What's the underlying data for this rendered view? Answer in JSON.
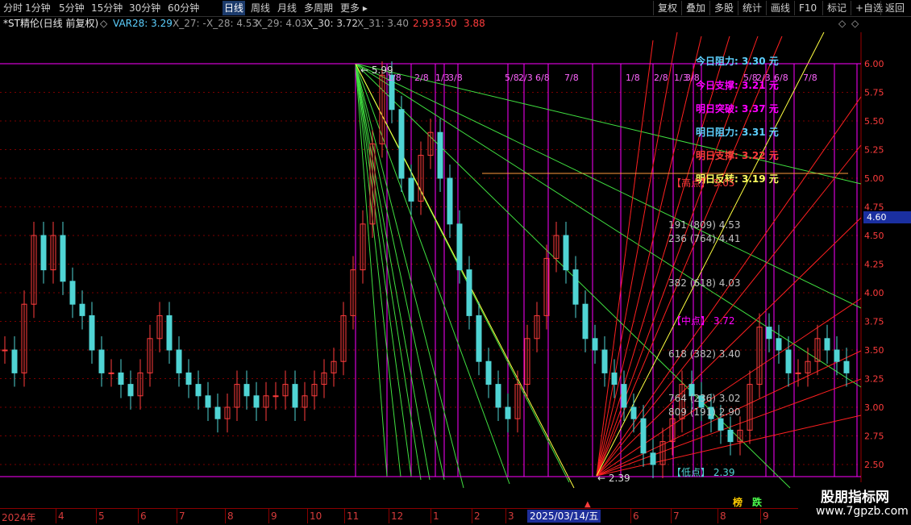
{
  "toolbar": {
    "periods": [
      "分时",
      "1分钟",
      "5分钟",
      "15分钟",
      "30分钟",
      "60分钟",
      "日线",
      "周线",
      "月线",
      "多周期",
      "更多"
    ],
    "active": "日线",
    "right": [
      "复权",
      "叠加",
      "多股",
      "统计",
      "画线",
      "F10",
      "标记",
      "+自选",
      "返回"
    ]
  },
  "info": {
    "title": "*ST精伦(日线 前复权)",
    "var28": "VAR28: 3.29",
    "x27": "X_27: -",
    "x28": "X_28: 4.53",
    "x29": "X_29: 4.03",
    "x30": "X_30: 3.72",
    "x31": "X_31: 3.40",
    "v1": "2.93",
    "v2": "3.50",
    "v3": "3.88"
  },
  "colors": {
    "bull": "#ff3c3c",
    "bear": "#50d4d4",
    "accent": "#ff00ff",
    "grid": "#8a0000"
  },
  "levels": {
    "today_resist": "今日阻力: 3.30 元",
    "today_support": "今日支撑: 3.21 元",
    "tomorrow_break": "明日突破: 3.37 元",
    "tomorrow_resist": "明日阻力: 3.31 元",
    "tomorrow_support": "明日支撑: 3.22 元",
    "tomorrow_reverse": "明日反转: 3.19 元"
  },
  "fib": {
    "high_label": "【高点】 5.05",
    "r191": "191 (809) 4.53",
    "r236": "236 (764) 4.41",
    "r382": "382 (618) 4.03",
    "mid": "【中点】 3.72",
    "r618": "618 (382) 3.40",
    "r764": "764 (236) 3.02",
    "r809": "809 (191) 2.90",
    "low_label": "【低点】 2.39"
  },
  "markers": {
    "peak": "5.99",
    "trough": "2.39",
    "price_now": "4.60",
    "fractions1": [
      "1/8",
      "2/8",
      "1/3",
      "3/8",
      "5/8",
      "2/3",
      "6/8",
      "7/8"
    ],
    "fractions2": [
      "1/8",
      "2/8",
      "1/3",
      "3/8",
      "5/8",
      "2/3",
      "6/8",
      "7/8"
    ],
    "bottom_tags": [
      "榜",
      "跌"
    ]
  },
  "yaxis": [
    "6.00",
    "5.75",
    "5.50",
    "5.25",
    "5.00",
    "4.75",
    "4.50",
    "4.25",
    "4.00",
    "3.75",
    "3.50",
    "3.25",
    "3.00",
    "2.75",
    "2.50"
  ],
  "xaxis": {
    "months": [
      "2024年",
      "4",
      "5",
      "6",
      "7",
      "8",
      "9",
      "10",
      "11",
      "12",
      "1",
      "2",
      "3",
      "5",
      "6",
      "7",
      "8",
      "9"
    ],
    "date_box": "2025/03/14/五"
  },
  "chart_data": {
    "type": "candlestick",
    "ylim": [
      2.39,
      6.0
    ],
    "closes": [
      3.5,
      3.3,
      3.9,
      4.5,
      4.2,
      4.5,
      4.1,
      3.9,
      3.8,
      3.5,
      3.3,
      3.3,
      3.2,
      3.1,
      3.3,
      3.6,
      3.8,
      3.5,
      3.3,
      3.2,
      3.1,
      3.0,
      2.9,
      3.0,
      3.2,
      3.1,
      3.0,
      3.1,
      3.1,
      3.2,
      3.0,
      3.1,
      3.2,
      3.3,
      3.4,
      3.8,
      4.2,
      4.6,
      5.3,
      5.9,
      5.6,
      5.0,
      4.8,
      5.2,
      5.4,
      5.0,
      4.6,
      4.2,
      3.8,
      3.4,
      3.2,
      3.0,
      2.9,
      3.2,
      3.6,
      3.8,
      4.3,
      4.5,
      4.2,
      3.9,
      3.6,
      3.5,
      3.3,
      3.2,
      3.0,
      2.9,
      2.6,
      2.5,
      2.7,
      2.9,
      3.2,
      3.1,
      3.0,
      2.9,
      2.8,
      2.7,
      2.8,
      3.2,
      3.7,
      3.6,
      3.5,
      3.3,
      3.3,
      3.4,
      3.6,
      3.5,
      3.4,
      3.3
    ]
  },
  "watermark": {
    "line1": "股朋指标网",
    "line2": "www.7gpzb.com"
  }
}
